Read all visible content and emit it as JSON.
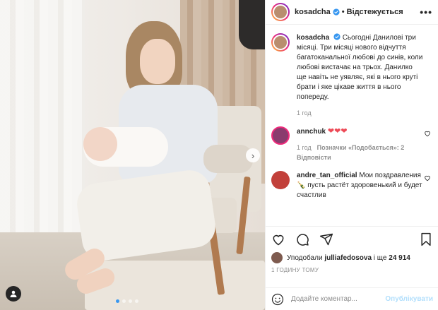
{
  "header": {
    "username": "kosadcha",
    "follow_label": "• Відстежується",
    "more_label": "•••"
  },
  "caption": {
    "username": "kosadcha",
    "text": "Сьогодні Данилові три місяці. Три місяці нового відчуття багатоканальної любові до синів, коли любові вистачає на трьох. Данилко ще навіть не уявляє, які в нього круті брати і яке цікаве життя в нього попереду.",
    "time": "1 год"
  },
  "comments": [
    {
      "username": "annchuk",
      "text": "❤❤❤",
      "time": "1 год",
      "likes": "Позначки «Подобається»: 2",
      "reply": "Відповісти",
      "avatar_color": "#8a3b6e"
    },
    {
      "username": "andre_tan_official",
      "text": "Мои поздравления 🍾 пусть растёт здоровенький и будет счастлив",
      "avatar_color": "#c2403a"
    }
  ],
  "actions": {
    "liked_by_prefix": "Уподобали",
    "liked_by_user": "julliafedosova",
    "liked_by_suffix": "і ще",
    "liked_count": "24 914",
    "timestamp": "1 ГОДИНУ ТОМУ"
  },
  "add_comment": {
    "placeholder": "Додайте коментар...",
    "publish_label": "Опублікувати"
  },
  "carousel": {
    "next_icon": "›",
    "dots": 4,
    "active_index": 0
  },
  "colors": {
    "accent": "#3897f0",
    "heart": "#ed4956",
    "muted": "#8e8e8e",
    "publish_disabled": "#b2dffc"
  }
}
